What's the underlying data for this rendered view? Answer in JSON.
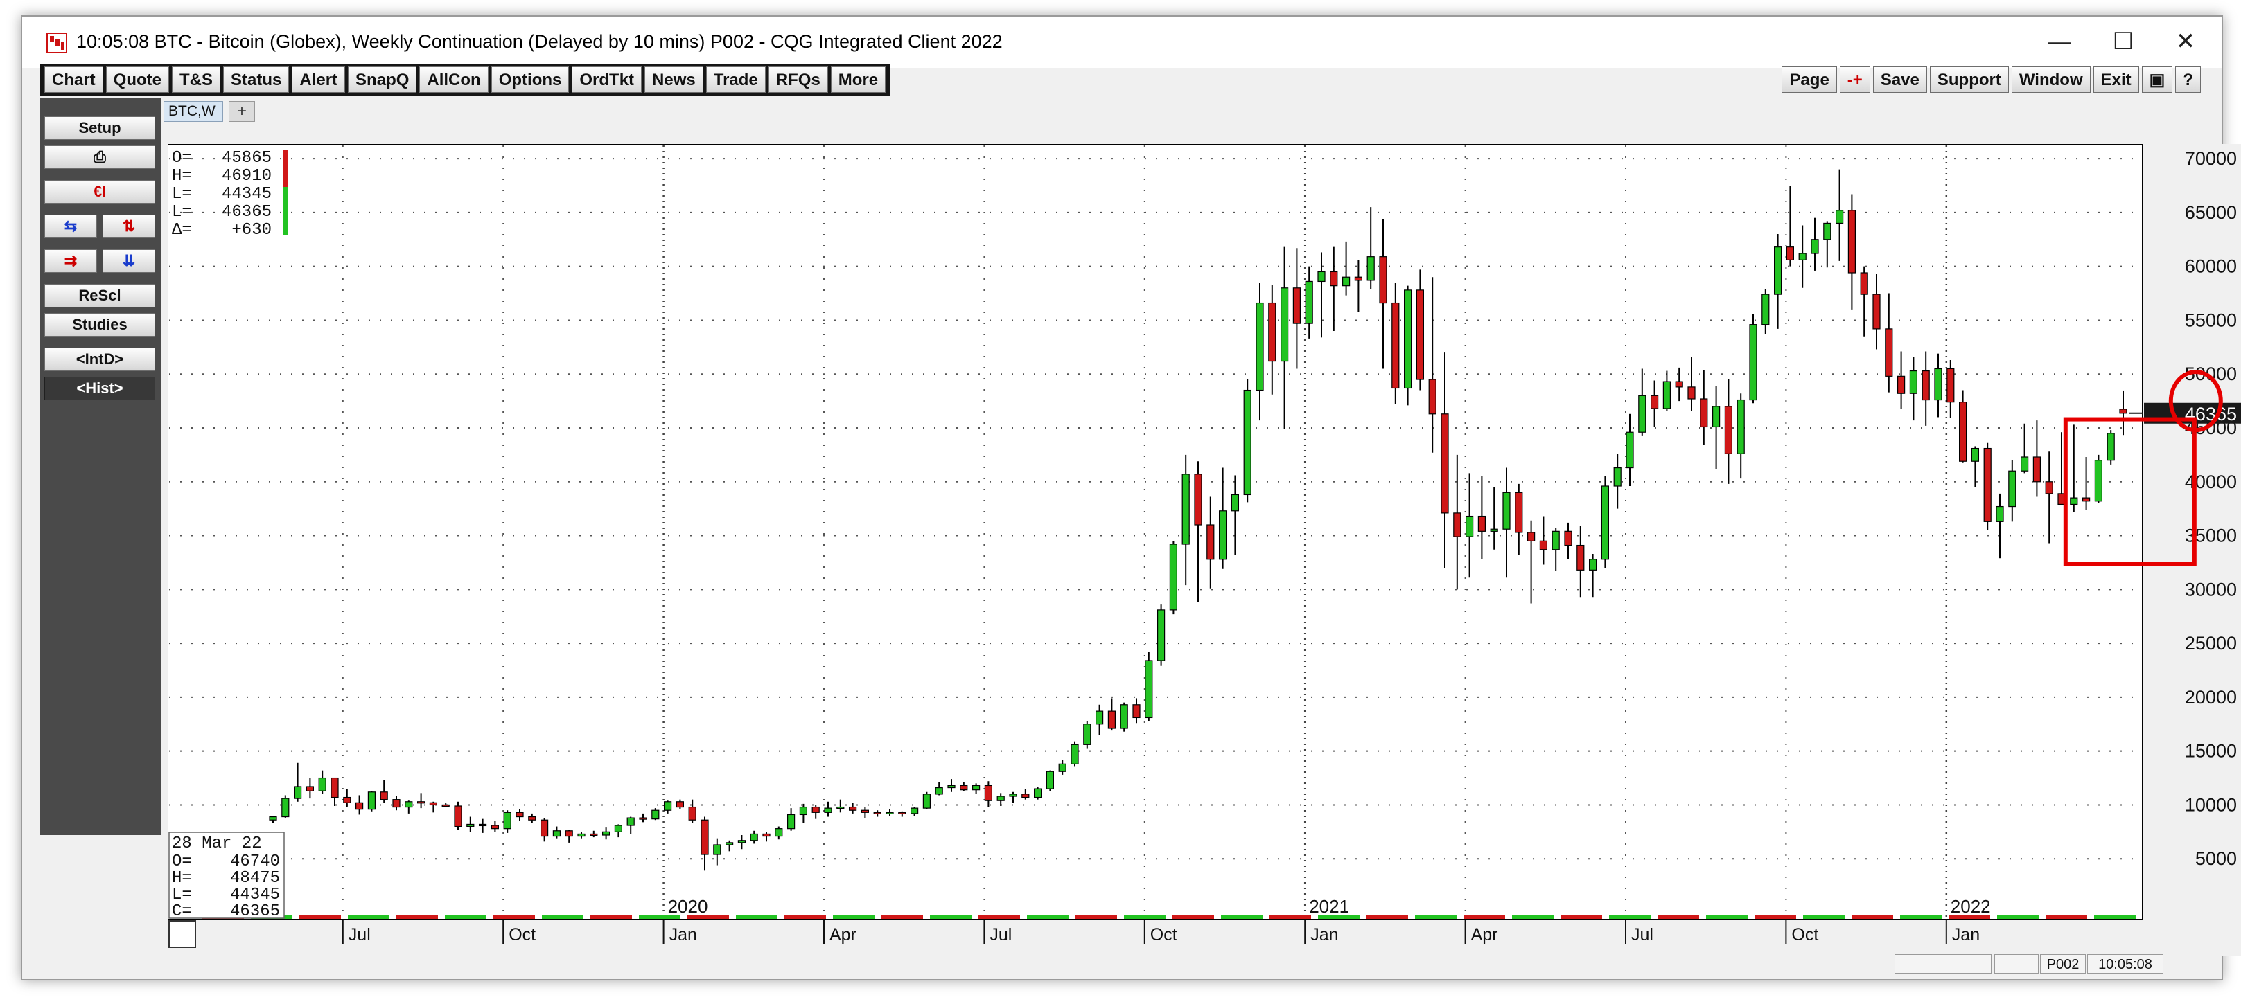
{
  "window": {
    "title": "10:05:08  BTC - Bitcoin (Globex), Weekly Continuation (Delayed by 10 mins)  P002 - CQG Integrated Client 2022",
    "controls": {
      "minimize": "—",
      "maximize": "☐",
      "close": "✕"
    }
  },
  "menu": {
    "left": [
      "Chart",
      "Quote",
      "T&S",
      "Status",
      "Alert",
      "SnapQ",
      "AllCon",
      "Options",
      "OrdTkt",
      "News",
      "Trade",
      "RFQs",
      "More"
    ],
    "right": [
      "Page",
      "-+",
      "Save",
      "Support",
      "Window",
      "Exit",
      "▣",
      "?"
    ]
  },
  "sidebar": {
    "setup": "Setup",
    "print": "⎙",
    "euro": "€l",
    "arrows": [
      "⇆",
      "⇅",
      "⇉",
      "⇊"
    ],
    "rescale": "ReScl",
    "studies": "Studies",
    "intd": "<IntD>",
    "hist": "<Hist>"
  },
  "tab": {
    "label": "BTC,W",
    "add": "+"
  },
  "statusbar": {
    "page": "P002",
    "time": "10:05:08"
  },
  "colors": {
    "up": "#22c322",
    "down": "#d01818",
    "highlight": "#e60000",
    "price_tag_bg": "#1a1a1a"
  },
  "chart_data": {
    "type": "candlestick",
    "symbol": "BTC,W",
    "ylim": [
      0,
      72000
    ],
    "yticks": [
      5000,
      10000,
      15000,
      20000,
      25000,
      30000,
      35000,
      40000,
      45000,
      50000,
      55000,
      60000,
      65000,
      70000
    ],
    "last_price_label": "46365",
    "last_price": 46365,
    "ohlc_box_top": {
      "O": "45865",
      "H": "46910",
      "L": "44345",
      "L2": "46365",
      "D": "+630"
    },
    "ohlc_box_top_labels": {
      "O": "O=",
      "H": "H=",
      "L": "L=",
      "L2": "L=",
      "D": "Δ="
    },
    "ohlc_box_bottom": {
      "date": "28 Mar 22",
      "O": "46740",
      "H": "48475",
      "L": "44345",
      "C": "46365"
    },
    "ohlc_box_bottom_labels": {
      "O": "O=",
      "H": "H=",
      "L": "L=",
      "C": "C="
    },
    "year_labels": [
      "2020",
      "2021",
      "2022"
    ],
    "month_labels": [
      "Jul",
      "Oct",
      "Jan",
      "Apr",
      "Jul",
      "Oct",
      "Jan",
      "Apr",
      "Jul",
      "Oct",
      "Jan"
    ],
    "candles": [
      [
        8600,
        9000,
        8300,
        8900
      ],
      [
        8900,
        10900,
        8800,
        10600
      ],
      [
        10600,
        13900,
        10300,
        11700
      ],
      [
        11700,
        12500,
        10600,
        11300
      ],
      [
        11300,
        13200,
        11000,
        12500
      ],
      [
        12500,
        12500,
        9900,
        10700
      ],
      [
        10700,
        11500,
        9800,
        10200
      ],
      [
        10200,
        10900,
        9100,
        9600
      ],
      [
        9600,
        11300,
        9400,
        11200
      ],
      [
        11200,
        12300,
        10200,
        10500
      ],
      [
        10500,
        10800,
        9500,
        9800
      ],
      [
        9800,
        10400,
        9200,
        10300
      ],
      [
        10300,
        11100,
        9700,
        10200
      ],
      [
        10200,
        10300,
        9300,
        10000
      ],
      [
        10000,
        10200,
        9800,
        9900
      ],
      [
        9900,
        10300,
        7700,
        8000
      ],
      [
        8000,
        8900,
        7500,
        8200
      ],
      [
        8200,
        8700,
        7400,
        8100
      ],
      [
        8100,
        8500,
        7500,
        7800
      ],
      [
        7800,
        9500,
        7400,
        9300
      ],
      [
        9300,
        9600,
        8500,
        8900
      ],
      [
        8900,
        9200,
        8300,
        8600
      ],
      [
        8600,
        8800,
        6600,
        7100
      ],
      [
        7100,
        8000,
        6900,
        7600
      ],
      [
        7600,
        7700,
        6500,
        7100
      ],
      [
        7100,
        7500,
        6900,
        7300
      ],
      [
        7300,
        7600,
        7000,
        7200
      ],
      [
        7200,
        7900,
        6800,
        7500
      ],
      [
        7500,
        8200,
        7000,
        8100
      ],
      [
        8100,
        8900,
        7300,
        8800
      ],
      [
        8800,
        9200,
        8400,
        8700
      ],
      [
        8700,
        9700,
        8600,
        9500
      ],
      [
        9500,
        10400,
        9200,
        10300
      ],
      [
        10300,
        10500,
        9600,
        9800
      ],
      [
        9800,
        10500,
        8300,
        8600
      ],
      [
        8600,
        8900,
        3900,
        5400
      ],
      [
        5400,
        6900,
        4400,
        6300
      ],
      [
        6300,
        6700,
        5700,
        6500
      ],
      [
        6500,
        7200,
        5900,
        6700
      ],
      [
        6700,
        7600,
        6400,
        7300
      ],
      [
        7300,
        7500,
        6600,
        7100
      ],
      [
        7100,
        8000,
        6800,
        7800
      ],
      [
        7800,
        9700,
        7600,
        9100
      ],
      [
        9100,
        10100,
        8300,
        9800
      ],
      [
        9800,
        10000,
        8700,
        9300
      ],
      [
        9300,
        10300,
        8900,
        9700
      ],
      [
        9700,
        10500,
        9300,
        9800
      ],
      [
        9800,
        10200,
        9200,
        9500
      ],
      [
        9500,
        9800,
        8800,
        9300
      ],
      [
        9300,
        9500,
        8900,
        9200
      ],
      [
        9200,
        9600,
        9000,
        9300
      ],
      [
        9300,
        9400,
        8900,
        9200
      ],
      [
        9200,
        9800,
        9000,
        9700
      ],
      [
        9700,
        11200,
        9600,
        11000
      ],
      [
        11000,
        12100,
        10900,
        11600
      ],
      [
        11600,
        12400,
        11200,
        11800
      ],
      [
        11800,
        12100,
        11300,
        11400
      ],
      [
        11400,
        12000,
        11000,
        11800
      ],
      [
        11800,
        12200,
        9800,
        10400
      ],
      [
        10400,
        11100,
        9900,
        10800
      ],
      [
        10800,
        11200,
        10200,
        11000
      ],
      [
        11000,
        11500,
        10500,
        10700
      ],
      [
        10700,
        11700,
        10500,
        11500
      ],
      [
        11500,
        13200,
        11300,
        13100
      ],
      [
        13100,
        14200,
        12800,
        13800
      ],
      [
        13800,
        15900,
        13600,
        15600
      ],
      [
        15600,
        17800,
        15200,
        17500
      ],
      [
        17500,
        19300,
        16500,
        18700
      ],
      [
        18700,
        19900,
        16900,
        17100
      ],
      [
        17100,
        19500,
        16800,
        19300
      ],
      [
        19300,
        19900,
        17600,
        18100
      ],
      [
        18100,
        24200,
        17800,
        23400
      ],
      [
        23400,
        28600,
        22900,
        28100
      ],
      [
        28100,
        34500,
        27700,
        34200
      ],
      [
        34200,
        42500,
        30400,
        40700
      ],
      [
        40700,
        41900,
        28800,
        36000
      ],
      [
        36000,
        38600,
        30100,
        32800
      ],
      [
        32800,
        41300,
        31900,
        37300
      ],
      [
        37300,
        40600,
        33200,
        38800
      ],
      [
        38800,
        49500,
        38100,
        48500
      ],
      [
        48500,
        58500,
        45700,
        56600
      ],
      [
        56600,
        58300,
        48100,
        51200
      ],
      [
        51200,
        61800,
        44900,
        58000
      ],
      [
        58000,
        61700,
        50500,
        54700
      ],
      [
        54700,
        60000,
        53300,
        58600
      ],
      [
        58600,
        61300,
        53400,
        59500
      ],
      [
        59500,
        61800,
        54000,
        58200
      ],
      [
        58200,
        62300,
        57300,
        59000
      ],
      [
        59000,
        60600,
        55800,
        58700
      ],
      [
        58700,
        65500,
        57900,
        60900
      ],
      [
        60900,
        64400,
        50500,
        56600
      ],
      [
        56600,
        58500,
        47200,
        48700
      ],
      [
        48700,
        58200,
        47100,
        57800
      ],
      [
        57800,
        59700,
        48500,
        49500
      ],
      [
        49500,
        59000,
        42700,
        46300
      ],
      [
        46300,
        52000,
        32000,
        37100
      ],
      [
        37100,
        42500,
        30000,
        34900
      ],
      [
        34900,
        40800,
        31100,
        36800
      ],
      [
        36800,
        40500,
        32800,
        35400
      ],
      [
        35400,
        39500,
        33700,
        35600
      ],
      [
        35600,
        41300,
        31100,
        39000
      ],
      [
        39000,
        39800,
        33200,
        35300
      ],
      [
        35300,
        36400,
        28700,
        34500
      ],
      [
        34500,
        36800,
        32300,
        33700
      ],
      [
        33700,
        35700,
        31700,
        35400
      ],
      [
        35400,
        36200,
        32800,
        34100
      ],
      [
        34100,
        35900,
        29300,
        31800
      ],
      [
        31800,
        33300,
        29300,
        32800
      ],
      [
        32800,
        40500,
        32000,
        39600
      ],
      [
        39600,
        42600,
        37500,
        41300
      ],
      [
        41300,
        46300,
        39600,
        44600
      ],
      [
        44600,
        50500,
        44300,
        48000
      ],
      [
        48000,
        49400,
        45100,
        46800
      ],
      [
        46800,
        50300,
        46600,
        49300
      ],
      [
        49300,
        50600,
        47500,
        48800
      ],
      [
        48800,
        51600,
        46600,
        47700
      ],
      [
        47700,
        50400,
        43400,
        45100
      ],
      [
        45100,
        48900,
        41200,
        47000
      ],
      [
        47000,
        49500,
        39800,
        42600
      ],
      [
        42600,
        48200,
        40300,
        47600
      ],
      [
        47600,
        55600,
        47300,
        54600
      ],
      [
        54600,
        57900,
        53700,
        57400
      ],
      [
        57400,
        63000,
        54200,
        61800
      ],
      [
        61800,
        67500,
        60000,
        60600
      ],
      [
        60600,
        63800,
        58000,
        61200
      ],
      [
        61200,
        64500,
        59600,
        62500
      ],
      [
        62500,
        64200,
        59900,
        64000
      ],
      [
        64000,
        69000,
        60500,
        65200
      ],
      [
        65200,
        66700,
        56000,
        59400
      ],
      [
        59400,
        60000,
        53500,
        57400
      ],
      [
        57400,
        59300,
        52300,
        54200
      ],
      [
        54200,
        57500,
        48300,
        49800
      ],
      [
        49800,
        52100,
        46800,
        48200
      ],
      [
        48200,
        51600,
        45700,
        50300
      ],
      [
        50300,
        52100,
        45200,
        47600
      ],
      [
        47600,
        51900,
        46000,
        50500
      ],
      [
        50500,
        51300,
        45900,
        47400
      ],
      [
        47400,
        48500,
        41800,
        41900
      ],
      [
        41900,
        43300,
        39500,
        43100
      ],
      [
        43100,
        43600,
        35500,
        36300
      ],
      [
        36300,
        38900,
        32900,
        37700
      ],
      [
        37700,
        42000,
        36300,
        41000
      ],
      [
        41000,
        45400,
        40800,
        42300
      ],
      [
        42300,
        45700,
        38600,
        40000
      ],
      [
        40000,
        42800,
        34300,
        38900
      ],
      [
        38900,
        44600,
        37900,
        37900
      ],
      [
        37900,
        45300,
        37200,
        38500
      ],
      [
        38500,
        42300,
        37400,
        38200
      ],
      [
        38200,
        42500,
        38000,
        42000
      ],
      [
        42000,
        44800,
        41600,
        44500
      ],
      [
        46740,
        48475,
        44345,
        46365
      ]
    ],
    "annotations": [
      {
        "shape": "rectangle",
        "from_week": 146,
        "to_week": 156,
        "y_low": 32400,
        "y_high": 45800,
        "color": "red"
      },
      {
        "shape": "circle",
        "at_week": 156,
        "y": 47500,
        "color": "red"
      }
    ]
  }
}
